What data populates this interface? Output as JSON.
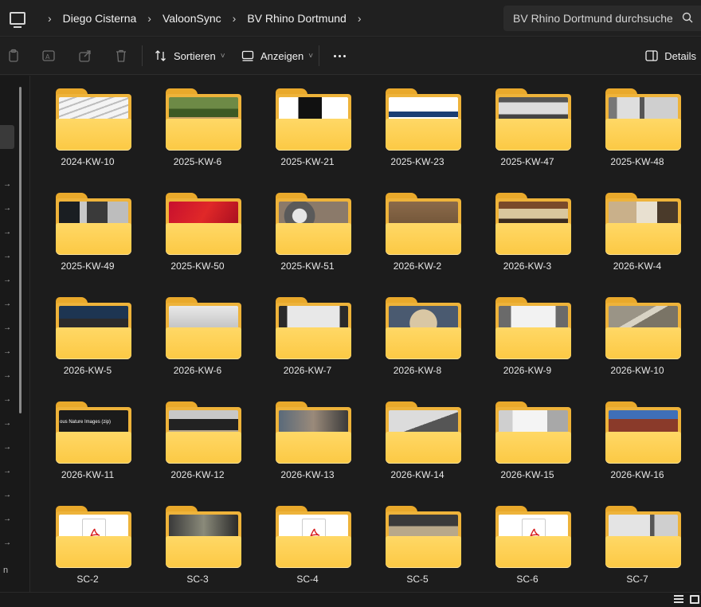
{
  "address_bar": {
    "breadcrumbs": [
      "Diego Cisterna",
      "ValoonSync",
      "BV Rhino Dortmund"
    ],
    "search_placeholder": "BV Rhino Dortmund durchsuchen"
  },
  "toolbar": {
    "sort_label": "Sortieren",
    "view_label": "Anzeigen",
    "details_label": "Details"
  },
  "folders": [
    {
      "name": "2024-KW-10",
      "thumb": "stairs"
    },
    {
      "name": "2025-KW-6",
      "thumb": "outdoor"
    },
    {
      "name": "2025-KW-21",
      "thumb": "black-triangle"
    },
    {
      "name": "2025-KW-23",
      "thumb": "logo"
    },
    {
      "name": "2025-KW-47",
      "thumb": "window-dark"
    },
    {
      "name": "2025-KW-48",
      "thumb": "window-frame"
    },
    {
      "name": "2025-KW-49",
      "thumb": "corridor"
    },
    {
      "name": "2025-KW-50",
      "thumb": "red-cloth"
    },
    {
      "name": "2025-KW-51",
      "thumb": "metal"
    },
    {
      "name": "2026-KW-2",
      "thumb": "brown"
    },
    {
      "name": "2026-KW-3",
      "thumb": "shop"
    },
    {
      "name": "2026-KW-4",
      "thumb": "shelf"
    },
    {
      "name": "2026-KW-5",
      "thumb": "dark-room"
    },
    {
      "name": "2026-KW-6",
      "thumb": "ceiling"
    },
    {
      "name": "2026-KW-7",
      "thumb": "window-bright"
    },
    {
      "name": "2026-KW-8",
      "thumb": "round"
    },
    {
      "name": "2026-KW-9",
      "thumb": "window-white"
    },
    {
      "name": "2026-KW-10",
      "thumb": "beam"
    },
    {
      "name": "2026-KW-11",
      "thumb": "caption",
      "caption": "ous Nature Images (zip)"
    },
    {
      "name": "2026-KW-12",
      "thumb": "interior"
    },
    {
      "name": "2026-KW-13",
      "thumb": "workers"
    },
    {
      "name": "2026-KW-14",
      "thumb": "car"
    },
    {
      "name": "2026-KW-15",
      "thumb": "white-room"
    },
    {
      "name": "2026-KW-16",
      "thumb": "brick"
    },
    {
      "name": "SC-2",
      "thumb": "pdf"
    },
    {
      "name": "SC-3",
      "thumb": "street"
    },
    {
      "name": "SC-4",
      "thumb": "pdf"
    },
    {
      "name": "SC-5",
      "thumb": "room-dark"
    },
    {
      "name": "SC-6",
      "thumb": "pdf"
    },
    {
      "name": "SC-7",
      "thumb": "window-light"
    }
  ],
  "sidebar": {
    "bottom_letter": "n"
  }
}
